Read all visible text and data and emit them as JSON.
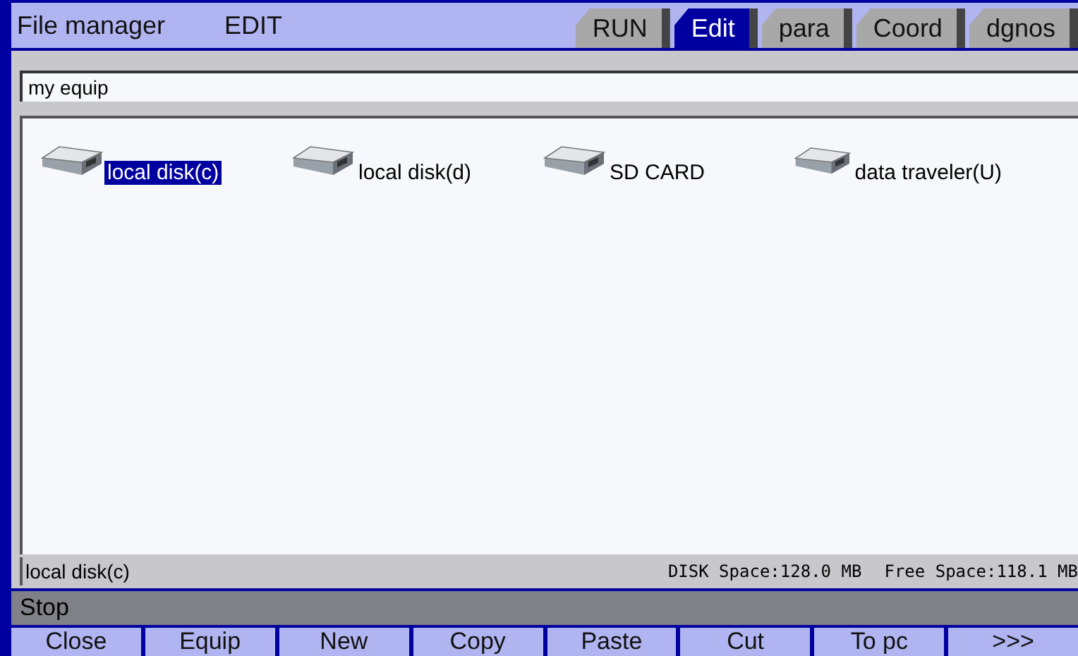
{
  "header": {
    "title": "File manager",
    "mode": "EDIT"
  },
  "tabs": [
    {
      "label": "RUN",
      "selected": false
    },
    {
      "label": "Edit",
      "selected": true
    },
    {
      "label": "para",
      "selected": false
    },
    {
      "label": "Coord",
      "selected": false
    },
    {
      "label": "dgnos",
      "selected": false
    }
  ],
  "path": {
    "value": "my equip"
  },
  "drives": [
    {
      "label": "local disk(c)",
      "selected": true
    },
    {
      "label": "local disk(d)",
      "selected": false
    },
    {
      "label": "SD CARD",
      "selected": false
    },
    {
      "label": "data traveler(U)",
      "selected": false
    }
  ],
  "status": {
    "name": "local disk(c)",
    "disk_space": "DISK Space:128.0 MB",
    "free_space": "Free Space:118.1 MB"
  },
  "state_bar": "Stop",
  "softkeys": [
    "Close",
    "Equip",
    "New",
    "Copy",
    "Paste",
    "Cut",
    "To pc",
    ">>>"
  ]
}
